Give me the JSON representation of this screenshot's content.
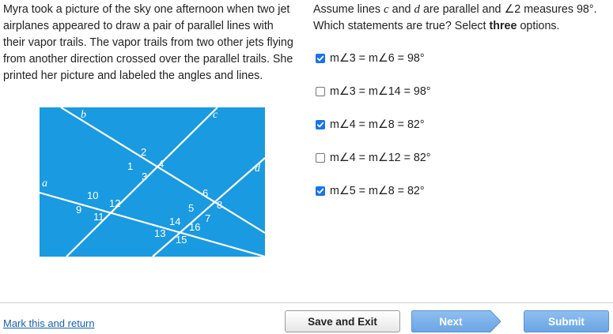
{
  "passage": "Myra took a picture of the sky one afternoon when two jet airplanes appeared to draw a pair of parallel lines with their vapor trails. The vapor trails from two other jets flying from another direction crossed over the parallel trails. She printed her picture and labeled the angles and lines.",
  "figure": {
    "background_color": "#1a9ae0",
    "line_labels": {
      "a": "a",
      "b": "b",
      "c": "c",
      "d": "d"
    },
    "angle_labels": [
      "1",
      "2",
      "3",
      "4",
      "5",
      "6",
      "7",
      "8",
      "9",
      "10",
      "11",
      "12",
      "13",
      "14",
      "15",
      "16"
    ]
  },
  "question": {
    "line1_pre": "Assume lines ",
    "line1_c": "c",
    "line1_and": " and ",
    "line1_d": "d",
    "line1_post": " are parallel and ∠2 measures 98°.",
    "line2_pre": "Which statements are true? Select ",
    "line2_bold": "three",
    "line2_post": " options."
  },
  "options": [
    {
      "label": "m∠3 = m∠6 = 98°",
      "checked": true
    },
    {
      "label": "m∠3 = m∠14 = 98°",
      "checked": false
    },
    {
      "label": "m∠4 = m∠8 = 82°",
      "checked": true
    },
    {
      "label": "m∠4 = m∠12 = 82°",
      "checked": false
    },
    {
      "label": "m∠5 = m∠8 = 82°",
      "checked": true
    }
  ],
  "footer": {
    "mark_link": "Mark this and return",
    "save_exit": "Save and Exit",
    "next": "Next",
    "submit": "Submit"
  },
  "colors": {
    "accent": "#1a73e8",
    "button_blue": "#7ab2ea"
  }
}
